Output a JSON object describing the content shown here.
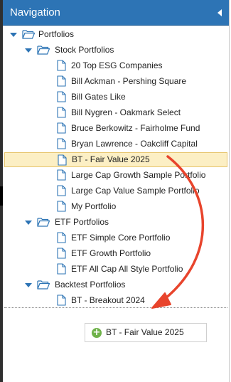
{
  "header": {
    "title": "Navigation"
  },
  "tree": {
    "root": "Portfolios",
    "groups": [
      {
        "label": "Stock Portfolios",
        "items": [
          "20 Top ESG Companies",
          "Bill Ackman - Pershing Square",
          "Bill Gates Like",
          "Bill Nygren - Oakmark Select",
          "Bruce Berkowitz - Fairholme Fund",
          "Bryan Lawrence - Oakcliff Capital",
          "BT - Fair Value 2025",
          "Large Cap Growth Sample Portfolio",
          "Large Cap Value Sample Portfolio",
          "My Portfolio"
        ]
      },
      {
        "label": "ETF Portfolios",
        "items": [
          "ETF Simple Core Portfolio",
          "ETF Growth Portfolio",
          "ETF All Cap All Style Portfolio"
        ]
      },
      {
        "label": "Backtest Portfolios",
        "items": [
          "BT - Breakout 2024"
        ]
      }
    ]
  },
  "drag": {
    "label": "BT - Fair Value 2025",
    "plus": "+"
  },
  "colors": {
    "header": "#2d74b5",
    "selected_bg": "#fcefc4",
    "arrow": "#e8442c",
    "add": "#6fb24a"
  }
}
